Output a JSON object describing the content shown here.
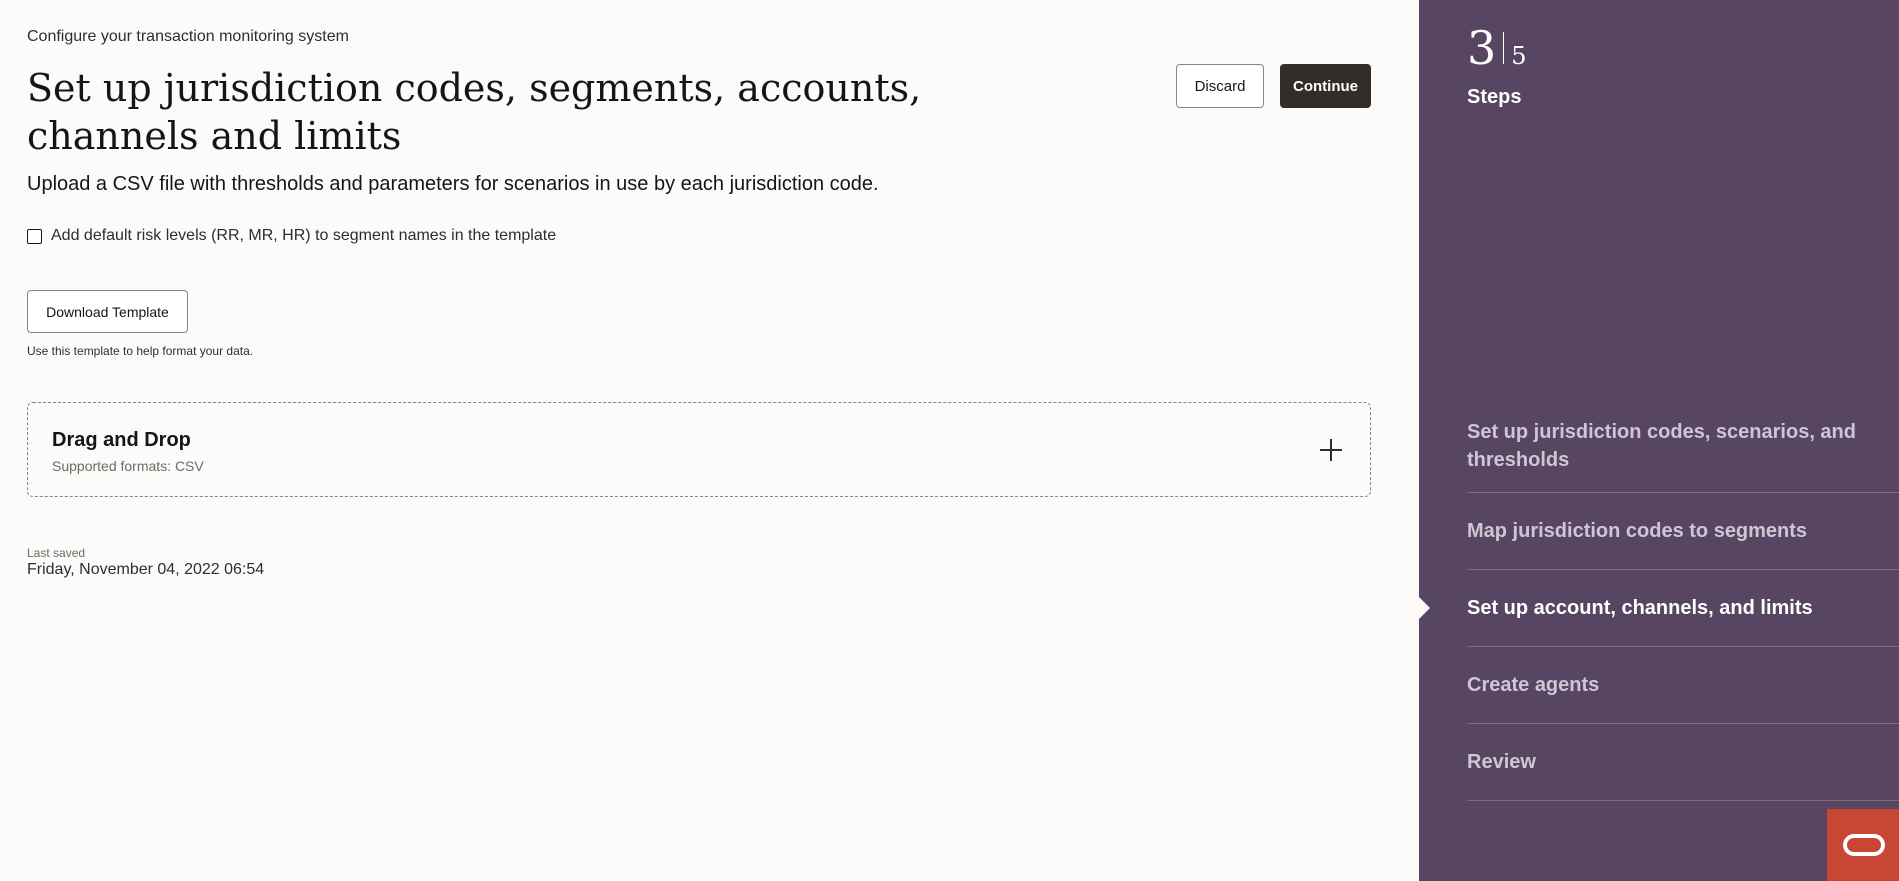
{
  "header": {
    "eyebrow": "Configure your transaction monitoring system",
    "title": "Set up jurisdiction codes, segments, accounts, channels and limits",
    "subtitle": "Upload a CSV file with thresholds and parameters for scenarios in use by each jurisdiction code."
  },
  "actions": {
    "discard_label": "Discard",
    "continue_label": "Continue"
  },
  "options": {
    "risk_levels_label": "Add default risk levels (RR, MR, HR) to segment names in the template",
    "risk_levels_checked": false
  },
  "template": {
    "download_label": "Download Template",
    "help_text": "Use this template to help format your data."
  },
  "dropzone": {
    "title": "Drag and Drop",
    "formats": "Supported formats: CSV",
    "icon": "plus-icon"
  },
  "save_status": {
    "label": "Last saved",
    "value": "Friday, November 04, 2022 06:54"
  },
  "steps_panel": {
    "current": "3",
    "total": "5",
    "label": "Steps",
    "items": [
      {
        "label": "Set up jurisdiction codes, scenarios, and thresholds",
        "active": false
      },
      {
        "label": "Map jurisdiction codes to segments",
        "active": false
      },
      {
        "label": "Set up account, channels, and limits",
        "active": true
      },
      {
        "label": "Create agents",
        "active": false
      },
      {
        "label": "Review",
        "active": false
      }
    ]
  },
  "colors": {
    "panel_bg": "#574561",
    "primary_button": "#312d2a",
    "help_button": "#c74634",
    "page_bg": "#fcfbfa"
  }
}
